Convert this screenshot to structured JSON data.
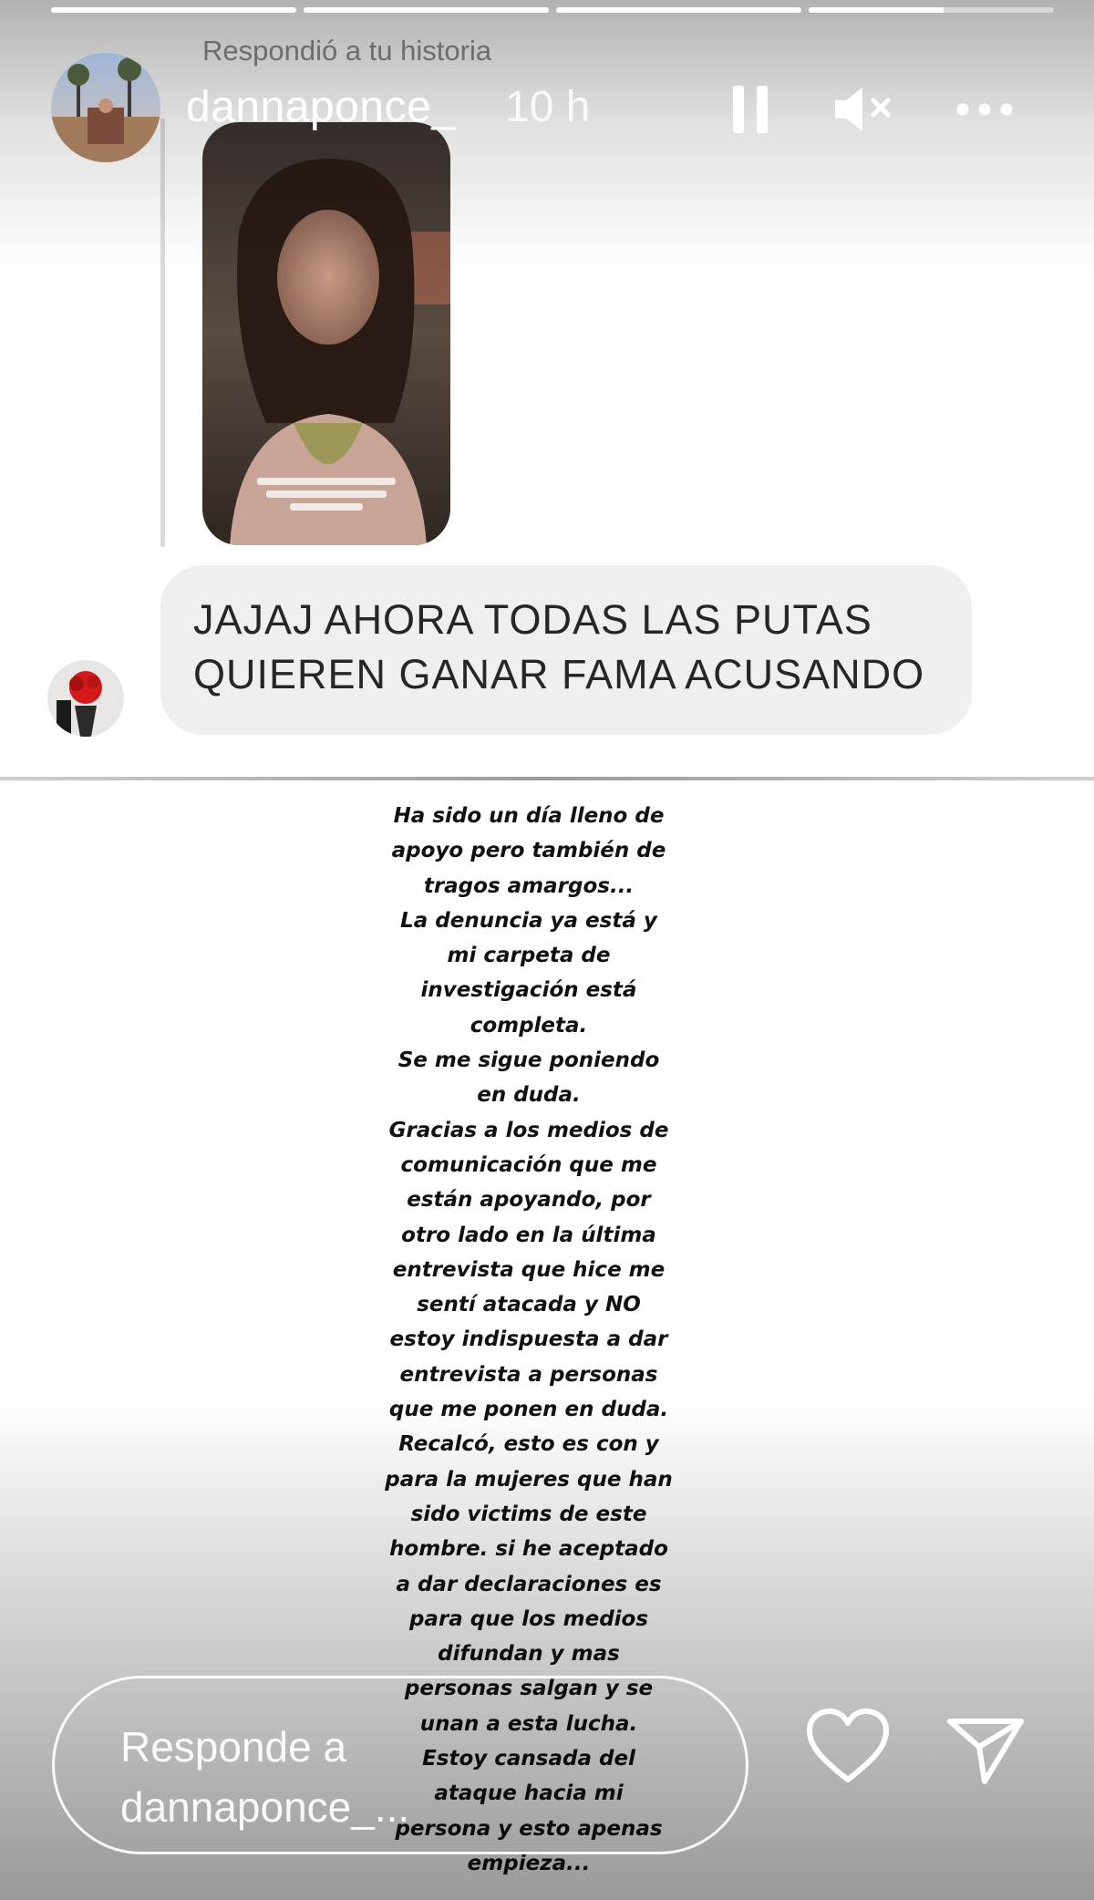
{
  "story": {
    "progress": [
      1,
      1,
      1,
      0.55
    ],
    "header": {
      "username": "dannaponce_",
      "time_ago": "10 h",
      "pause_icon": "pause-icon",
      "mute_icon": "speaker-muted-icon",
      "more_icon": "more-options-icon"
    }
  },
  "reply_card": {
    "label": "Respondió a tu historia",
    "message": "JAJAJ AHORA TODAS LAS PUTAS QUIEREN GANAR FAMA ACUSANDO"
  },
  "statement": {
    "text": "Ha sido un día lleno de\napoyo pero también de\ntragos amargos...\nLa denuncia ya está y\nmi carpeta de\ninvestigación está\ncompleta.\nSe me sigue poniendo\nen duda.\nGracias a los medios de\ncomunicación que me\nestán apoyando, por\notro lado en la última\nentrevista que hice me\nsentí atacada y NO\nestoy indispuesta a dar\nentrevista a personas\nque me ponen en duda.\nRecalcó, esto es con y\npara la mujeres que han\nsido victims de este\nhombre. si he aceptado\na dar declaraciones es\npara que los medios\ndifundan y mas\npersonas salgan y se\nunan a esta lucha.\nEstoy cansada del\nataque hacia mi\npersona y esto apenas\nempieza..."
  },
  "reply_bar": {
    "placeholder": "Responde a\ndannaponce_...",
    "like_icon": "heart-icon",
    "send_icon": "send-icon"
  },
  "colors": {
    "bubble": "#efefef",
    "bubble_text": "#262626",
    "label": "#8c8c8c"
  }
}
